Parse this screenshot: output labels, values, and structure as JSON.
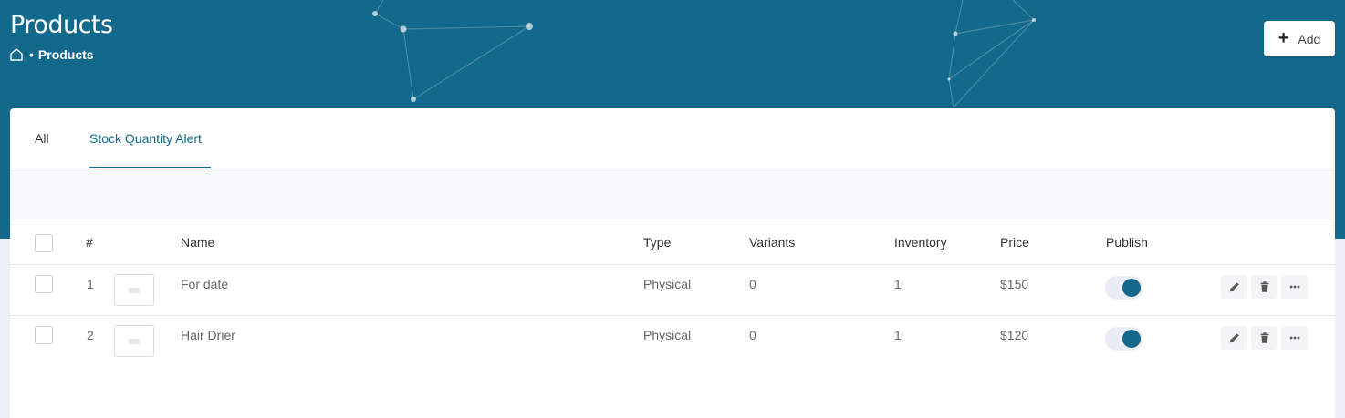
{
  "page": {
    "title": "Products",
    "breadcrumb": {
      "separator": "•",
      "current": "Products"
    },
    "add_label": "Add"
  },
  "tabs": [
    "All",
    "Stock Quantity Alert"
  ],
  "active_tab": "Stock Quantity Alert",
  "table": {
    "columns": {
      "index": "#",
      "name": "Name",
      "type": "Type",
      "variants": "Variants",
      "inventory": "Inventory",
      "price": "Price",
      "publish": "Publish"
    },
    "rows": [
      {
        "index": "1",
        "name": "For date",
        "type": "Physical",
        "variants": "0",
        "inventory": "1",
        "price": "$150",
        "published": true
      },
      {
        "index": "2",
        "name": "Hair Drier",
        "type": "Physical",
        "variants": "0",
        "inventory": "1",
        "price": "$120",
        "published": true
      }
    ]
  },
  "icons": {
    "home": "home-icon",
    "add": "plus-icon",
    "edit": "pencil-icon",
    "delete": "trash-icon",
    "more": "more-horizontal-icon"
  },
  "colors": {
    "primary": "#12698b",
    "background": "#eef0f7"
  }
}
